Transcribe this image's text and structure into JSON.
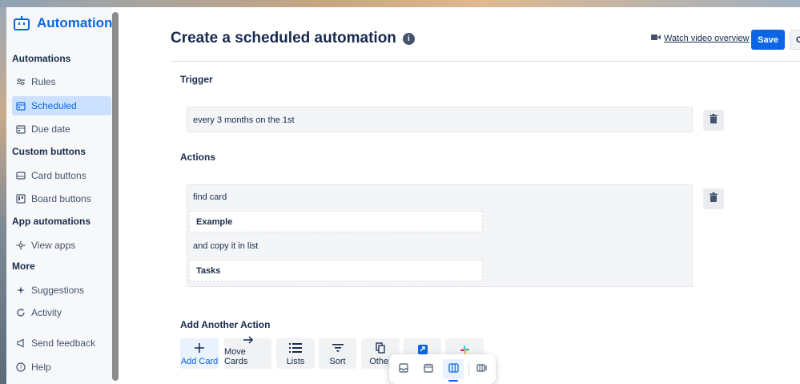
{
  "app": {
    "title": "Automation",
    "accent": "#0c66e4"
  },
  "sidebar": {
    "sections": [
      {
        "title": "Automations",
        "items": [
          {
            "label": "Rules",
            "icon": "sliders-icon"
          },
          {
            "label": "Scheduled",
            "icon": "calendar-icon",
            "active": true
          },
          {
            "label": "Due date",
            "icon": "calendar-icon"
          }
        ]
      },
      {
        "title": "Custom buttons",
        "items": [
          {
            "label": "Card buttons",
            "icon": "card-icon"
          },
          {
            "label": "Board buttons",
            "icon": "board-icon"
          }
        ]
      },
      {
        "title": "App automations",
        "items": [
          {
            "label": "View apps",
            "icon": "gear-icon"
          }
        ]
      },
      {
        "title": "More",
        "items": [
          {
            "label": "Suggestions",
            "icon": "sparkle-icon"
          },
          {
            "label": "Activity",
            "icon": "refresh-icon"
          },
          {
            "label": "Send feedback",
            "icon": "megaphone-icon"
          },
          {
            "label": "Help",
            "icon": "help-icon"
          }
        ]
      }
    ]
  },
  "header": {
    "title": "Create a scheduled automation",
    "watch_label": "Watch video overview",
    "save_label": "Save",
    "cancel_label": "C"
  },
  "trigger": {
    "heading": "Trigger",
    "text": "every 3 months on the 1st"
  },
  "actions": {
    "heading": "Actions",
    "line1": "find card",
    "chip1": "Example",
    "line2": "and copy it in list",
    "chip2": "Tasks"
  },
  "add_action": {
    "heading": "Add Another Action",
    "buttons": [
      {
        "label": "Add Card",
        "icon": "plus-icon"
      },
      {
        "label": "Move Cards",
        "icon": "arrow-right-icon"
      },
      {
        "label": "Lists",
        "icon": "list-icon"
      },
      {
        "label": "Sort",
        "icon": "sort-icon"
      },
      {
        "label": "Other",
        "icon": "copy-icon"
      },
      {
        "label": "",
        "icon": "app-icon"
      },
      {
        "label": "",
        "icon": "slack-icon"
      }
    ]
  },
  "floating_toolbar": {
    "items": [
      "inbox-icon",
      "calendar-icon",
      "board-view-icon",
      "switch-boards-icon"
    ],
    "active_index": 2
  }
}
